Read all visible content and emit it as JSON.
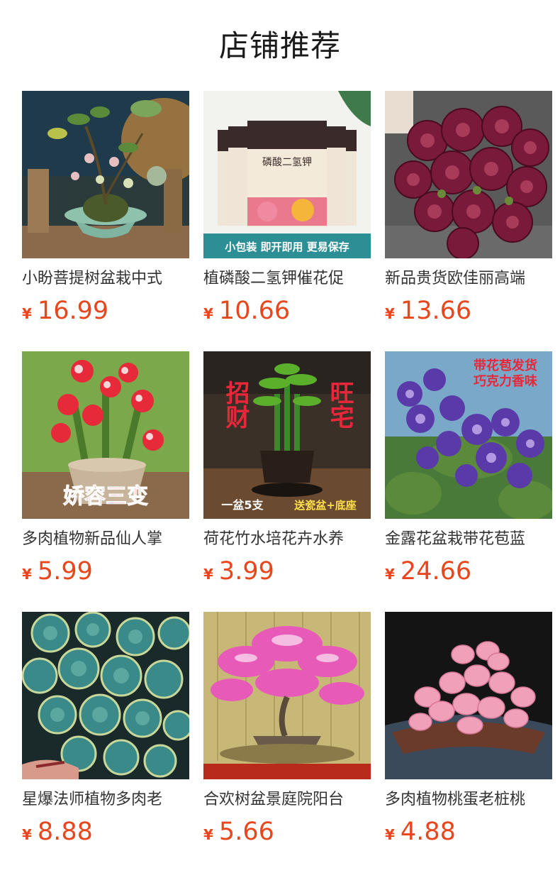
{
  "section_title": "店铺推荐",
  "currency_symbol": "¥",
  "products": [
    {
      "name": "小盼菩提树盆栽中式",
      "price": "16.99",
      "image": "bonsai-tree-in-lotus-pot"
    },
    {
      "name": "植磷酸二氢钾催花促",
      "price": "10.66",
      "image": "fertilizer-packets",
      "image_text": {
        "packet_label": "磷酸二氢钾",
        "banner": "小包装 即开即用 更易保存"
      }
    },
    {
      "name": "新品贵货欧佳丽高端",
      "price": "13.66",
      "image": "red-succulent-cluster"
    },
    {
      "name": "多肉植物新品仙人掌",
      "price": "5.99",
      "image": "red-white-cactus-flowers",
      "image_text": {
        "caption": "娇容三变"
      }
    },
    {
      "name": "荷花竹水培花卉水养",
      "price": "3.99",
      "image": "lucky-bamboo-pot",
      "image_text": {
        "left": "招财",
        "right": "旺宅",
        "bottom_left": "一盆5支",
        "bottom_right": "送瓷盆+底座"
      }
    },
    {
      "name": "金露花盆栽带花苞蓝",
      "price": "24.66",
      "image": "purple-flower-bush",
      "image_text": {
        "line1": "带花苞发货",
        "line2": "巧克力香味"
      }
    },
    {
      "name": "星爆法师植物多肉老",
      "price": "8.88",
      "image": "blue-green-succulents"
    },
    {
      "name": "合欢树盆景庭院阳台",
      "price": "5.66",
      "image": "pink-mimosa-bonsai"
    },
    {
      "name": "多肉植物桃蛋老桩桃",
      "price": "4.88",
      "image": "pink-jellybean-succulent"
    }
  ]
}
